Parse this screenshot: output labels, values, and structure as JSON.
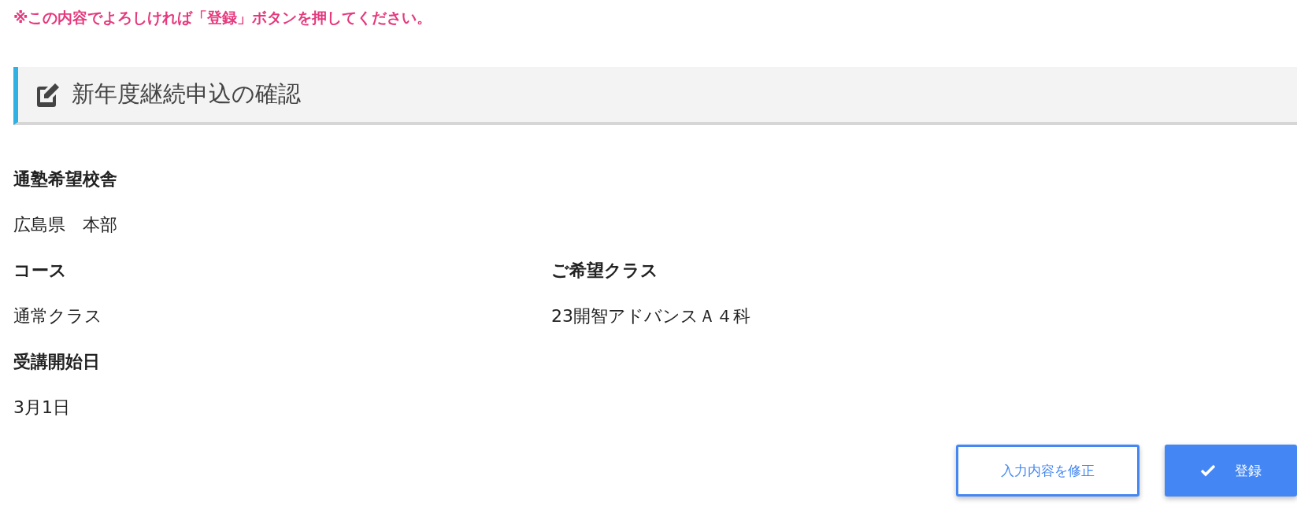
{
  "notice": "※この内容でよろしければ「登録」ボタンを押してください。",
  "section": {
    "title": "新年度継続申込の確認"
  },
  "rows": [
    [
      {
        "label": "通塾希望校舎",
        "value": "広島県　本部"
      }
    ],
    [
      {
        "label": "コース",
        "value": "通常クラス"
      },
      {
        "label": "ご希望クラス",
        "value": "23開智アドバンスＡ４科"
      }
    ],
    [
      {
        "label": "受講開始日",
        "value": "3月1日"
      }
    ]
  ],
  "buttons": [
    {
      "kind": "outline",
      "label": "入力内容を修正"
    },
    {
      "kind": "primary",
      "label": "登録"
    }
  ]
}
